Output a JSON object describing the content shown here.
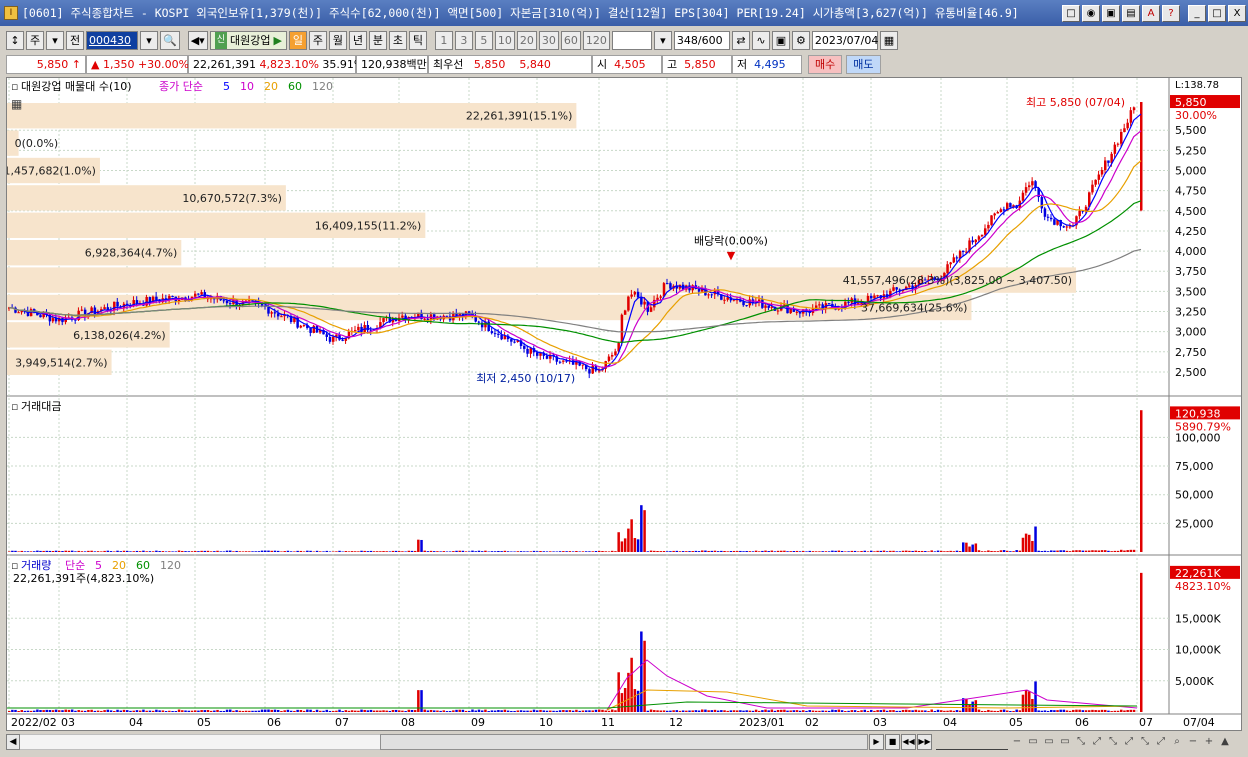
{
  "window": {
    "title": "[0601] 주식종합차트 - KOSPI 외국인보유[1,379(천)] 주식수[62,000(천)] 액면[500] 자본금[310(억)] 결산[12월] EPS[304] PER[19.24] 시가총액[3,627(억)] 유통비율[46.9]",
    "app_icon": "I",
    "buttons": [
      "□",
      "◉",
      "▣",
      "▤",
      "A",
      "?",
      "_",
      "□",
      "X"
    ]
  },
  "toolbar": {
    "market": "주",
    "mode": "전",
    "code": "000430",
    "stock_name": "대원강업",
    "stock_badge": "신",
    "periods": [
      "일",
      "주",
      "월",
      "년",
      "분",
      "초",
      "틱"
    ],
    "active_period": "일",
    "intervals": [
      "1",
      "3",
      "5",
      "10",
      "20",
      "30",
      "60",
      "120"
    ],
    "count": "348",
    "count_total": "/600",
    "date": "2023/07/04"
  },
  "info": {
    "price": "5,850",
    "change": "1,350",
    "change_pct": "+30.00%",
    "volume": "22,261,391",
    "volume_ratio": "4,823.10%",
    "turnover": "35.91%",
    "amount": "120,938백만",
    "bid_label": "최우선",
    "ask": "5,850",
    "bid": "5,840",
    "open_label": "시",
    "open": "4,505",
    "high_label": "고",
    "high": "5,850",
    "low_label": "저",
    "low": "4,495",
    "buy": "매수",
    "sell": "매도"
  },
  "price_panel": {
    "title": "대원강업 매물대 수(10)",
    "legend_prefix": "종가 단순",
    "ma_periods": [
      "5",
      "10",
      "20",
      "60",
      "120"
    ],
    "ma_colors": [
      "#0000ff",
      "#cc00cc",
      "#e8a000",
      "#009000",
      "#808080"
    ],
    "y_ticks": [
      "5,500",
      "5,250",
      "5,000",
      "4,750",
      "4,500",
      "4,250",
      "4,000",
      "3,750",
      "3,500",
      "3,250",
      "3,000",
      "2,750",
      "2,500"
    ],
    "top_label": "L:138.78",
    "current_label": "5,850",
    "current_pct": "30.00%",
    "annotations": {
      "high": "최고 5,850 (07/04)",
      "low": "최저 2,450 (10/17)",
      "dividend": "배당락(0.00%)"
    },
    "volume_profile": [
      {
        "label": "22,261,391(15.1%)",
        "w": 0.49
      },
      {
        "label": "0(0.0%)",
        "w": 0.01
      },
      {
        "label": "1,457,682(1.0%)",
        "w": 0.08
      },
      {
        "label": "10,670,572(7.3%)",
        "w": 0.24
      },
      {
        "label": "16,409,155(11.2%)",
        "w": 0.36
      },
      {
        "label": "6,928,364(4.7%)",
        "w": 0.15
      },
      {
        "label": "41,557,496(28.3%)(3,825.00 ~ 3,407.50)",
        "w": 0.92
      },
      {
        "label": "37,669,634(25.6%)",
        "w": 0.83
      },
      {
        "label": "6,138,026(4.2%)",
        "w": 0.14
      },
      {
        "label": "3,949,514(2.7%)",
        "w": 0.09
      }
    ]
  },
  "amount_panel": {
    "title": "거래대금",
    "y_ticks": [
      "100,000",
      "75,000",
      "50,000",
      "25,000"
    ],
    "current_label": "120,938",
    "current_pct": "5890.79%"
  },
  "volume_panel": {
    "title": "거래량",
    "legend_prefix": "단순",
    "ma_periods": [
      "5",
      "20",
      "60",
      "120"
    ],
    "subtitle": "22,261,391주(4,823.10%)",
    "y_ticks": [
      "15,000K",
      "10,000K",
      "5,000K"
    ],
    "current_label": "22,261K",
    "current_pct": "4823.10%"
  },
  "x_axis": {
    "labels": [
      "2022/02",
      "03",
      "04",
      "05",
      "06",
      "07",
      "08",
      "09",
      "10",
      "11",
      "12",
      "2023/01",
      "02",
      "03",
      "04",
      "05",
      "06",
      "07"
    ],
    "right_label": "07/04"
  },
  "chart_data": {
    "type": "candlestick",
    "price_range": [
      2400,
      5900
    ],
    "months": [
      "2022/02",
      "03",
      "04",
      "05",
      "06",
      "07",
      "08",
      "09",
      "10",
      "11",
      "12",
      "2023/01",
      "02",
      "03",
      "04",
      "05",
      "06",
      "07"
    ],
    "close_by_month": [
      3300,
      3150,
      3350,
      3450,
      3300,
      2900,
      3200,
      3200,
      2700,
      2500,
      3600,
      3400,
      3250,
      3400,
      3700,
      4600,
      4300,
      5850
    ],
    "low": {
      "value": 2450,
      "date": "10/17"
    },
    "high": {
      "value": 5850,
      "date": "07/04"
    }
  }
}
